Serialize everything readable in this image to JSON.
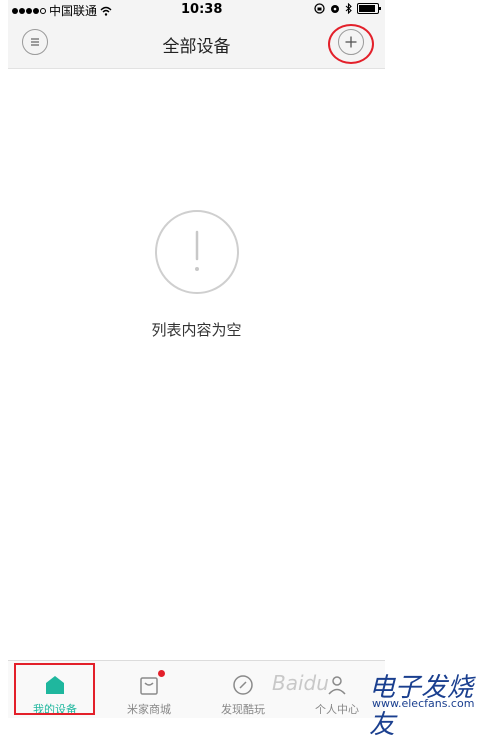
{
  "status_bar": {
    "carrier": "中国联通",
    "time": "10:38"
  },
  "header": {
    "title": "全部设备",
    "menu_icon": "menu-lines-icon",
    "add_icon": "plus-icon"
  },
  "empty_state": {
    "icon": "exclamation-icon",
    "message": "列表内容为空"
  },
  "tab_bar": {
    "tabs": [
      {
        "label": "我的设备",
        "icon": "home-icon",
        "active": true
      },
      {
        "label": "米家商城",
        "icon": "shopping-bag-icon",
        "badge": true
      },
      {
        "label": "发现酷玩",
        "icon": "compass-icon"
      },
      {
        "label": "个人中心",
        "icon": "person-icon"
      }
    ]
  },
  "watermark": {
    "baidu": "Baidu",
    "logo": "电子发烧友",
    "url": "www.elecfans.com"
  },
  "colors": {
    "accent": "#1fb79e",
    "highlight": "#e3202a",
    "watermark": "#1a3f8f"
  }
}
